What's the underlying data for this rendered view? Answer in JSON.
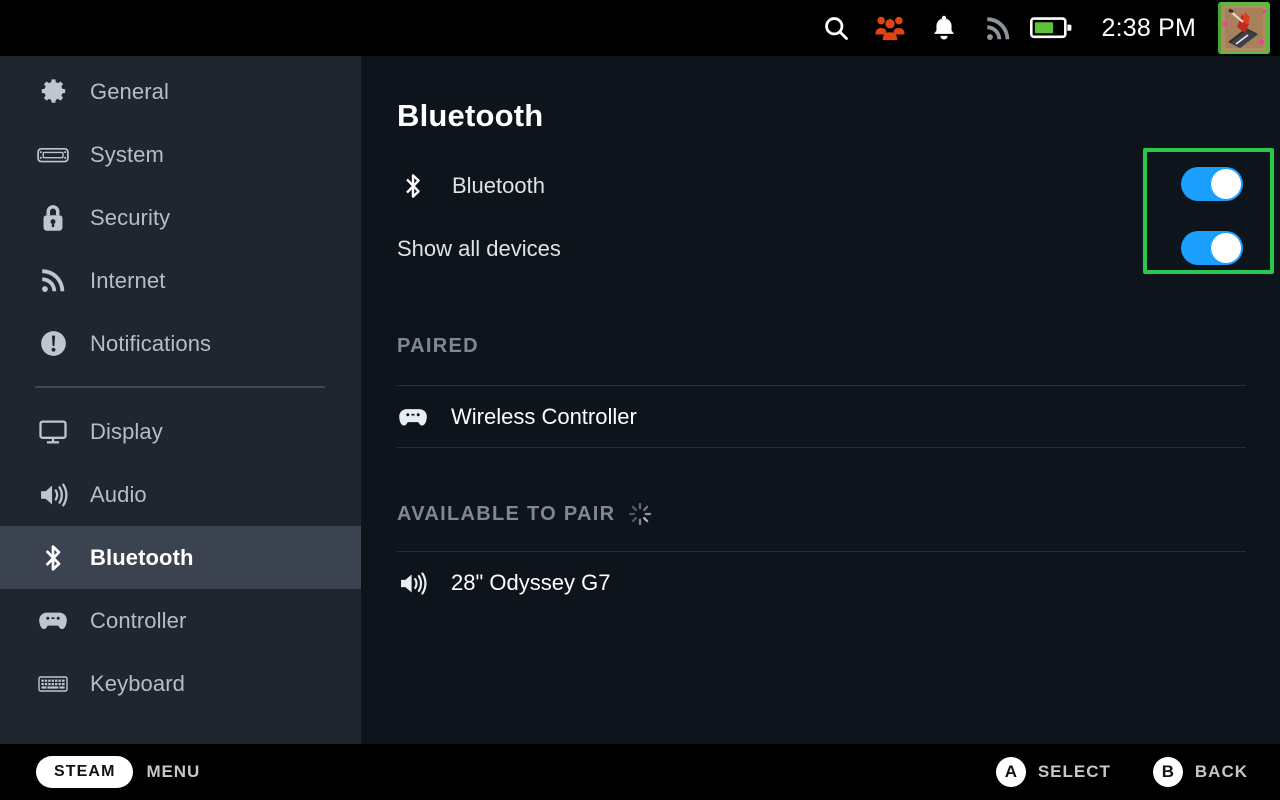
{
  "statusbar": {
    "icons": [
      {
        "name": "search-icon",
        "glyph": "search"
      },
      {
        "name": "friends-icon",
        "glyph": "friends",
        "color": "#e04414"
      },
      {
        "name": "notifications-bell-icon",
        "glyph": "bell"
      },
      {
        "name": "wifi-signal-icon",
        "glyph": "wifi"
      },
      {
        "name": "battery-icon",
        "glyph": "battery",
        "level_percent": 60,
        "color": "#5cc33a"
      }
    ],
    "time": "2:38 PM",
    "avatar_alt": "user-avatar"
  },
  "sidebar": {
    "items": [
      {
        "label": "General",
        "icon": "gear-icon",
        "selected": false
      },
      {
        "label": "System",
        "icon": "steamdeck-icon",
        "selected": false
      },
      {
        "label": "Security",
        "icon": "lock-icon",
        "selected": false
      },
      {
        "label": "Internet",
        "icon": "wifi-icon",
        "selected": false
      },
      {
        "label": "Notifications",
        "icon": "exclamation-icon",
        "selected": false
      }
    ],
    "items2": [
      {
        "label": "Display",
        "icon": "monitor-icon",
        "selected": false
      },
      {
        "label": "Audio",
        "icon": "speaker-icon",
        "selected": false
      },
      {
        "label": "Bluetooth",
        "icon": "bluetooth-icon",
        "selected": true
      },
      {
        "label": "Controller",
        "icon": "gamepad-icon",
        "selected": false
      },
      {
        "label": "Keyboard",
        "icon": "keyboard-icon",
        "selected": false
      }
    ]
  },
  "main": {
    "title": "Bluetooth",
    "settings": [
      {
        "label": "Bluetooth",
        "icon": "bluetooth-icon",
        "toggle": "on"
      },
      {
        "label": "Show all devices",
        "icon": "none",
        "toggle": "on"
      }
    ],
    "sections": [
      {
        "heading": "PAIRED",
        "spinner": false,
        "devices": [
          {
            "name": "Wireless Controller",
            "icon": "gamepad-icon"
          }
        ]
      },
      {
        "heading": "AVAILABLE TO PAIR",
        "spinner": true,
        "devices": [
          {
            "name": "28\" Odyssey G7",
            "icon": "speaker-icon"
          }
        ]
      }
    ],
    "highlight_color": "#28c84b",
    "toggle_on_color": "#1a9fff"
  },
  "bottombar": {
    "steam_label": "STEAM",
    "menu_label": "MENU",
    "hints": [
      {
        "button": "A",
        "label": "SELECT"
      },
      {
        "button": "B",
        "label": "BACK"
      }
    ]
  }
}
